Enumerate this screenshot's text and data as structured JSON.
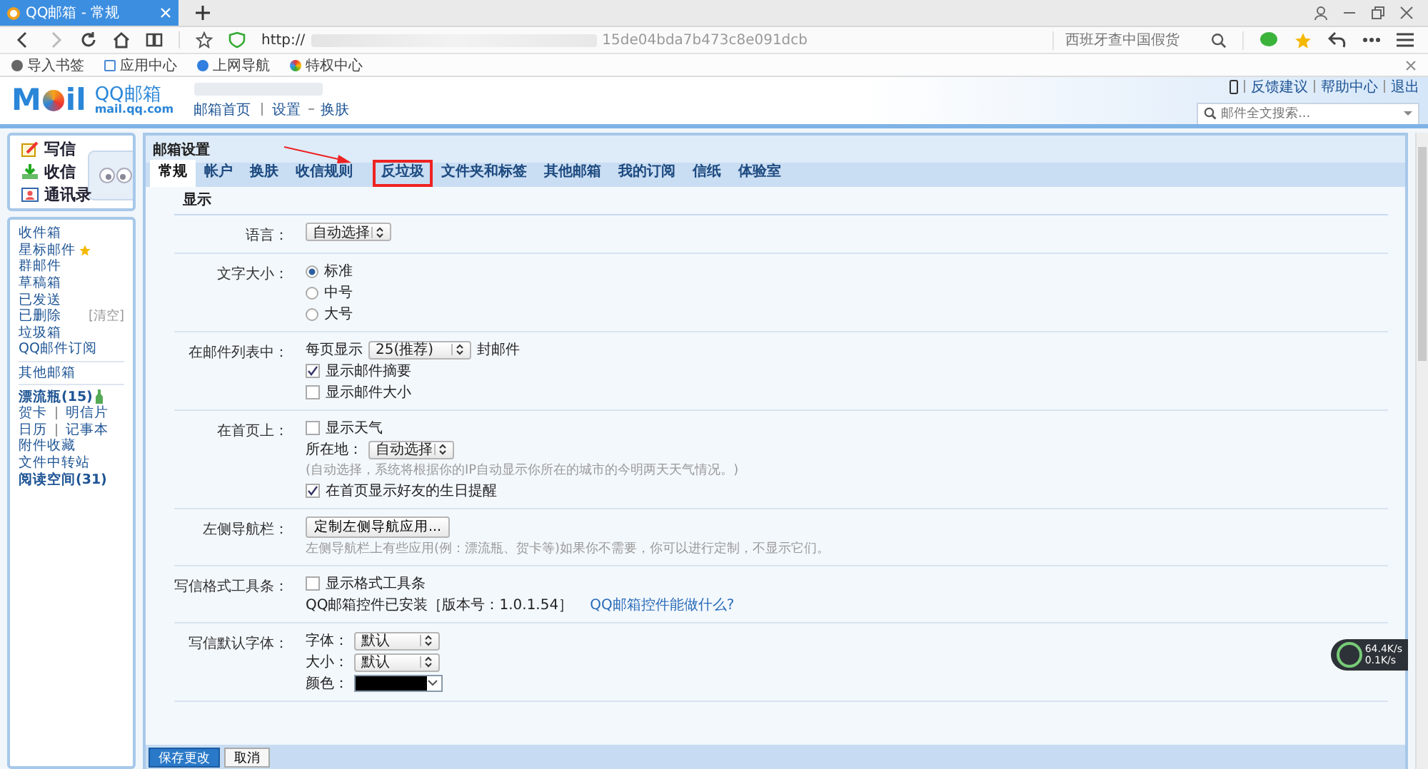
{
  "browser": {
    "tabs": [
      {
        "title": "QQ邮箱 - 常规",
        "selected": true
      }
    ],
    "url": "http://",
    "url_tail": "15de04bda7b473c8e091dcb",
    "search_placeholder": "西班牙查中国假货",
    "bookmarks": [
      "导入书签",
      "应用中心",
      "上网导航",
      "特权中心"
    ]
  },
  "header": {
    "logo": [
      "M",
      "il"
    ],
    "brand": "QQ邮箱",
    "domain": "mail.qq.com",
    "links": [
      "邮箱首页",
      "设置",
      "换肤"
    ],
    "top_links": [
      "反馈建议",
      "帮助中心",
      "退出"
    ],
    "search_placeholder": "邮件全文搜索..."
  },
  "sidebar": {
    "actions": [
      {
        "label": "写信",
        "kind": "write"
      },
      {
        "label": "收信",
        "kind": "inbox"
      },
      {
        "label": "通讯录",
        "kind": "contacts"
      }
    ],
    "groups": [
      [
        {
          "label": "收件箱"
        },
        {
          "label": "星标邮件",
          "kind": "star"
        },
        {
          "label": "群邮件"
        },
        {
          "label": "草稿箱"
        },
        {
          "label": "已发送"
        },
        {
          "label": "已删除",
          "extra": "[清空]"
        },
        {
          "label": "垃圾箱"
        },
        {
          "label": "QQ邮件订阅"
        }
      ],
      [
        {
          "label": "其他邮箱"
        }
      ],
      [
        {
          "label": "漂流瓶(15)",
          "kind": "bottle",
          "bold": true
        },
        {
          "label": "贺卡",
          "second": "明信片"
        },
        {
          "label": "日历",
          "second": "记事本"
        },
        {
          "label": "附件收藏"
        },
        {
          "label": "文件中转站"
        },
        {
          "label": "阅读空间(31)",
          "bold": true
        }
      ]
    ]
  },
  "settings": {
    "title": "邮箱设置",
    "tabs": [
      {
        "label": "常规",
        "selected": true,
        "highlighted": false
      },
      {
        "label": "帐户",
        "selected": false,
        "highlighted": false
      },
      {
        "label": "换肤",
        "selected": false,
        "highlighted": false
      },
      {
        "label": "收信规则",
        "selected": false,
        "highlighted": false
      },
      {
        "label": "反垃圾",
        "selected": false,
        "highlighted": true
      },
      {
        "label": "文件夹和标签",
        "selected": false,
        "highlighted": false
      },
      {
        "label": "其他邮箱",
        "selected": false,
        "highlighted": false
      },
      {
        "label": "我的订阅",
        "selected": false,
        "highlighted": false
      },
      {
        "label": "信纸",
        "selected": false,
        "highlighted": false
      },
      {
        "label": "体验室",
        "selected": false,
        "highlighted": false
      }
    ],
    "section": "显示",
    "rows": [
      {
        "label": "语言：",
        "items": [
          {
            "kind": "select",
            "value": "自动选择"
          }
        ]
      },
      {
        "label": "文字大小：",
        "items": [
          {
            "kind": "radio",
            "label": "标准",
            "selected": true
          },
          {
            "kind": "radio",
            "label": "中号",
            "selected": false
          },
          {
            "kind": "radio",
            "label": "大号",
            "selected": false
          }
        ]
      },
      {
        "label": "在邮件列表中：",
        "items": [
          {
            "kind": "select",
            "prefix": "每页显示",
            "value": "25(推荐)",
            "suffix": "封邮件"
          },
          {
            "kind": "checkbox",
            "label": "显示邮件摘要",
            "checked": true
          },
          {
            "kind": "checkbox",
            "label": "显示邮件大小",
            "checked": false
          }
        ]
      },
      {
        "label": "在首页上：",
        "items": [
          {
            "kind": "checkbox",
            "label": "显示天气",
            "checked": false
          },
          {
            "kind": "select",
            "prefix": "所在地：",
            "value": "自动选择"
          },
          {
            "kind": "hint",
            "text": "(自动选择，系统将根据你的IP自动显示你所在的城市的今明两天天气情况。)"
          },
          {
            "kind": "checkbox",
            "label": "在首页显示好友的生日提醒",
            "checked": true
          }
        ]
      },
      {
        "label": "左侧导航栏：",
        "items": [
          {
            "kind": "button",
            "label": "定制左侧导航应用..."
          },
          {
            "kind": "hint",
            "text": "左侧导航栏上有些应用(例：漂流瓶、贺卡等)如果你不需要，你可以进行定制，不显示它们。"
          }
        ]
      },
      {
        "label": "写信格式工具条：",
        "items": [
          {
            "kind": "checkbox",
            "label": "显示格式工具条",
            "checked": false
          },
          {
            "kind": "info",
            "text": "QQ邮箱控件已安装［版本号：1.0.1.54］",
            "link": "QQ邮箱控件能做什么?"
          }
        ]
      },
      {
        "label": "写信默认字体：",
        "items": [
          {
            "kind": "select",
            "prefix": "字体：",
            "value": "默认"
          },
          {
            "kind": "select",
            "prefix": "大小：",
            "value": "默认"
          },
          {
            "kind": "color",
            "prefix": "颜色：",
            "color": "#000000"
          }
        ]
      }
    ],
    "buttons": [
      "保存更改",
      "取消"
    ]
  },
  "speed_widget": {
    "up": "64.4K/s",
    "down": "0.1K/s"
  }
}
